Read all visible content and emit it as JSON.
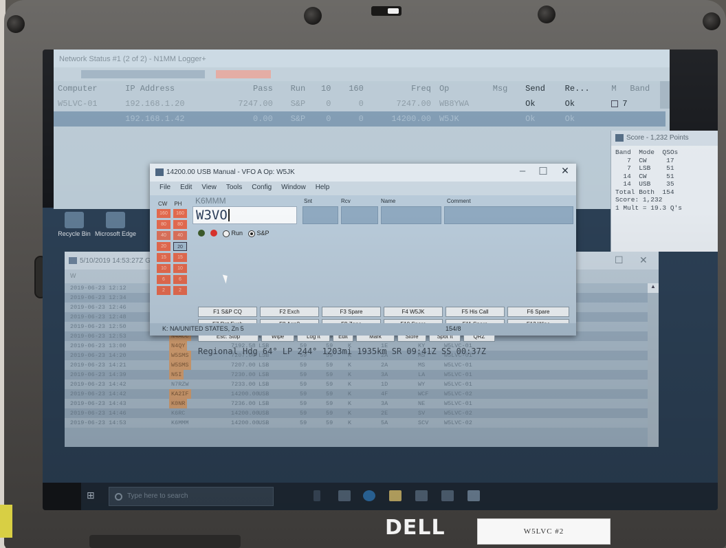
{
  "hardware": {
    "brand": "DELL",
    "asset_tag": "W5LVC #2"
  },
  "network_window": {
    "title": "Network Status #1 (2 of 2) - N1MM Logger+",
    "columns": [
      "Computer",
      "IP Address",
      "Pass",
      "Run",
      "10",
      "160",
      "Freq",
      "Op",
      "Msg",
      "Send",
      "Re...",
      "M",
      "Band"
    ],
    "rows": [
      {
        "computer": "W5LVC-01",
        "ip": "192.168.1.20",
        "pass": "7247.00",
        "run": "S&P",
        "c10": "0",
        "c160": "0",
        "freq": "7247.00",
        "op": "WB8YWA",
        "msg": "",
        "send": "Ok",
        "recv": "Ok",
        "band": "7"
      },
      {
        "computer": "",
        "ip": "192.168.1.42",
        "pass": "0.00",
        "run": "S&P",
        "c10": "0",
        "c160": "0",
        "freq": "14200.00",
        "op": "W5JK",
        "msg": "",
        "send": "Ok",
        "recv": "Ok",
        "band": ""
      }
    ]
  },
  "score_window": {
    "title": "Score - 1,232 Points",
    "header": "Band  Mode  QSOs",
    "lines": [
      "   7  CW     17",
      "   7  LSB    51",
      "  14  CW     51",
      "  14  USB    35",
      "Total Both  154",
      "Score: 1,232",
      "1 Mult = 19.3 Q's"
    ]
  },
  "desktop": {
    "icons": [
      "Recycle Bin",
      "Microsoft Edge"
    ]
  },
  "log_window": {
    "title": "5/10/2019 14:53:27Z Gen",
    "filter": "W",
    "rows": [
      {
        "time": "2019-06-23 12:12",
        "call": "",
        "freq": "",
        "mode": "",
        "snt": "",
        "rcv": "",
        "pr": "",
        "sec": "",
        "st": "",
        "station": ""
      },
      {
        "time": "2019-06-23 12:34",
        "call": "",
        "freq": "",
        "mode": "",
        "snt": "",
        "rcv": "",
        "pr": "",
        "sec": "",
        "st": "",
        "station": ""
      },
      {
        "time": "2019-06-23 12:46",
        "call": "",
        "freq": "",
        "mode": "",
        "snt": "",
        "rcv": "",
        "pr": "",
        "sec": "",
        "st": "",
        "station": ""
      },
      {
        "time": "2019-06-23 12:48",
        "call": "",
        "freq": "",
        "mode": "",
        "snt": "",
        "rcv": "",
        "pr": "",
        "sec": "",
        "st": "",
        "station": ""
      },
      {
        "time": "2019-06-23 12:50",
        "call": "",
        "freq": "",
        "mode": "",
        "snt": "",
        "rcv": "",
        "pr": "",
        "sec": "",
        "st": "",
        "station": ""
      },
      {
        "time": "2019-06-23 12:53",
        "call": "N4ACC",
        "freq": "7296.41",
        "mode": "LSB",
        "snt": "59",
        "rcv": "59",
        "pr": "K",
        "sec": "3A",
        "st": "NC",
        "station": "W5LVC-02"
      },
      {
        "time": "2019-06-23 13:00",
        "call": "N4QY",
        "freq": "7192.58",
        "mode": "LSB",
        "snt": "59",
        "rcv": "59",
        "pr": "K",
        "sec": "1E",
        "st": "KY",
        "station": "W5LVC-01"
      },
      {
        "time": "2019-06-23 14:20",
        "call": "W5SMS",
        "freq": "7207.00",
        "mode": "LSB",
        "snt": "59",
        "rcv": "59",
        "pr": "K",
        "sec": "2A",
        "st": "MS",
        "station": "W5LVC-01"
      },
      {
        "time": "2019-06-23 14:21",
        "call": "W5SMS",
        "freq": "7207.00",
        "mode": "LSB",
        "snt": "59",
        "rcv": "59",
        "pr": "K",
        "sec": "2A",
        "st": "MS",
        "station": "W5LVC-01"
      },
      {
        "time": "2019-06-23 14:39",
        "call": "N5I",
        "freq": "7230.00",
        "mode": "LSB",
        "snt": "59",
        "rcv": "59",
        "pr": "K",
        "sec": "3A",
        "st": "LA",
        "station": "W5LVC-01"
      },
      {
        "time": "2019-06-23 14:42",
        "call": "N7RZW",
        "freq": "7233.00",
        "mode": "LSB",
        "snt": "59",
        "rcv": "59",
        "pr": "K",
        "sec": "1D",
        "st": "WY",
        "station": "W5LVC-01"
      },
      {
        "time": "2019-06-23 14:42",
        "call": "KA2IF",
        "freq": "14200.00",
        "mode": "USB",
        "snt": "59",
        "rcv": "59",
        "pr": "K",
        "sec": "4F",
        "st": "WCF",
        "station": "W5LVC-02"
      },
      {
        "time": "2019-06-23 14:43",
        "call": "K0NR",
        "freq": "7236.00",
        "mode": "LSB",
        "snt": "59",
        "rcv": "59",
        "pr": "K",
        "sec": "3A",
        "st": "NE",
        "station": "W5LVC-01"
      },
      {
        "time": "2019-06-23 14:46",
        "call": "K6RC",
        "freq": "14200.00",
        "mode": "USB",
        "snt": "59",
        "rcv": "59",
        "pr": "K",
        "sec": "2E",
        "st": "SV",
        "station": "W5LVC-02"
      },
      {
        "time": "2019-06-23 14:53",
        "call": "K6MMM",
        "freq": "14200.00",
        "mode": "USB",
        "snt": "59",
        "rcv": "59",
        "pr": "K",
        "sec": "5A",
        "st": "SCV",
        "station": "W5LVC-02"
      }
    ]
  },
  "entry_window": {
    "title": "14200.00 USB Manual - VFO A   Op: W5JK",
    "menu": [
      "File",
      "Edit",
      "View",
      "Tools",
      "Config",
      "Window",
      "Help"
    ],
    "band_headers": [
      "CW",
      "PH"
    ],
    "bands": [
      "160",
      "80",
      "40",
      "20",
      "15",
      "10",
      "6",
      "2"
    ],
    "last_call": "K6MMM",
    "callsign": "W3VO",
    "field_headers": [
      "Snt",
      "Rcv",
      "Name",
      "Comment"
    ],
    "mode_run": "Run",
    "mode_sp": "S&P",
    "fkeys_row1": [
      "F1 S&P CQ",
      "F2 Exch",
      "F3 Spare",
      "F4 W5JK",
      "F5 His Call",
      "F6 Spare"
    ],
    "fkeys_row2": [
      "F7 Rpt Exch",
      "F8 Agn?",
      "F9 Zone",
      "F10 Spare",
      "F11 Spare",
      "F12 Wipe"
    ],
    "fkeys_row3": [
      "Esc: Stop",
      "Wipe",
      "Log It",
      "Edit",
      "Mark",
      "Store",
      "Spot It",
      "QRZ"
    ],
    "info": "Regional Hdg 64° LP 244° 1203mi 1935km SR 09:41Z SS 00:37Z",
    "status_left": "K: NA/UNITED STATES, Zn 5",
    "status_right": "154/8"
  },
  "taskbar": {
    "search_placeholder": "Type here to search"
  }
}
